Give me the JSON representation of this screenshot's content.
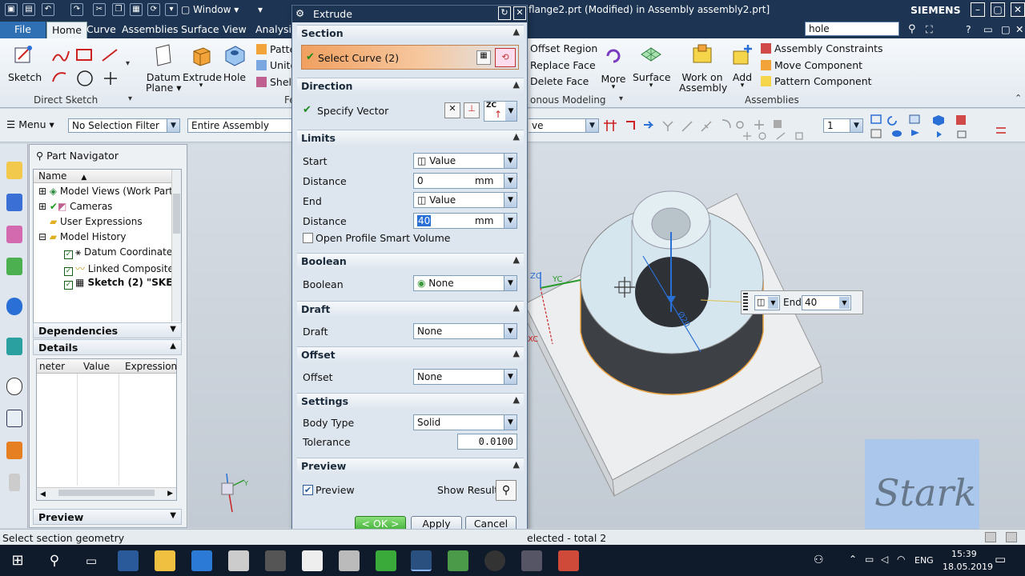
{
  "titlebar": {
    "window_menu": "Window",
    "title": "flange2.prt (Modified)  in Assembly assembly2.prt]",
    "brand": "SIEMENS",
    "search_value": "hole"
  },
  "tabs": [
    "File",
    "Home",
    "Curve",
    "Assemblies",
    "Surface",
    "View",
    "Analysis"
  ],
  "ribbon": {
    "sketch": "Sketch",
    "direct_sketch_group": "Direct Sketch",
    "datum_plane_1": "Datum",
    "datum_plane_2": "Plane",
    "extrude": "Extrude",
    "hole": "Hole",
    "pattern_partial": "Patte",
    "unite_partial": "Unite",
    "shell_partial": "Shell",
    "feature_group_partial": "Fe",
    "offset_region": "Offset Region",
    "replace_face": "Replace Face",
    "delete_face": "Delete Face",
    "synchronous_group": "onous Modeling",
    "more": "More",
    "surface": "Surface",
    "work_on_assembly_1": "Work on",
    "work_on_assembly_2": "Assembly",
    "add": "Add",
    "assembly_constraints": "Assembly Constraints",
    "move_component": "Move Component",
    "pattern_component": "Pattern Component",
    "assemblies_group": "Assemblies"
  },
  "toolbar": {
    "menu": "Menu",
    "selection_filter": "No Selection Filter",
    "scope": "Entire Assembly",
    "snap_partial": "ve",
    "layer_value": "1"
  },
  "part_navigator": {
    "title": "Part Navigator",
    "column_name": "Name",
    "rows": [
      "Model Views (Work Part",
      "Cameras",
      "User Expressions",
      "Model History",
      "Datum Coordinate",
      "Linked Composite",
      "Sketch (2) \"SKET"
    ],
    "dependencies": "Dependencies",
    "details": "Details",
    "details_columns": [
      "neter",
      "Value",
      "Expression"
    ],
    "preview": "Preview"
  },
  "dialog": {
    "title": "Extrude",
    "section": {
      "header": "Section",
      "select_curve": "Select Curve (2)"
    },
    "direction": {
      "header": "Direction",
      "specify_vector": "Specify Vector",
      "vector_label": "ZC"
    },
    "limits": {
      "header": "Limits",
      "start_label": "Start",
      "start_value": "Value",
      "distance1_label": "Distance",
      "distance1_value": "0",
      "unit1": "mm",
      "end_label": "End",
      "end_value": "Value",
      "distance2_label": "Distance",
      "distance2_value": "40",
      "unit2": "mm",
      "open_profile": "Open Profile Smart Volume"
    },
    "boolean": {
      "header": "Boolean",
      "label": "Boolean",
      "value": "None"
    },
    "draft": {
      "header": "Draft",
      "label": "Draft",
      "value": "None"
    },
    "offset": {
      "header": "Offset",
      "label": "Offset",
      "value": "None"
    },
    "settings": {
      "header": "Settings",
      "body_type_label": "Body Type",
      "body_type_value": "Solid",
      "tolerance_label": "Tolerance",
      "tolerance_value": "0.0100"
    },
    "preview": {
      "header": "Preview",
      "preview_label": "Preview",
      "show_result": "Show Result"
    },
    "buttons": {
      "ok": "< OK >",
      "apply": "Apply",
      "cancel": "Cancel"
    }
  },
  "viewport": {
    "end_label": "End",
    "end_value": "40",
    "dim_label": "Ø20",
    "axis_zc": "ZC",
    "axis_yc": "YC",
    "axis_xc": "XC",
    "triad_y": "Y",
    "watermark": "Stark"
  },
  "statusbar": {
    "left": "Select section geometry",
    "right": "elected - total 2"
  },
  "taskbar": {
    "language": "ENG",
    "time": "15:39",
    "date": "18.05.2019"
  },
  "colors": {
    "title_bg": "#1d3553",
    "accent": "#2f6fb3",
    "select_highlight": "#f0a060"
  }
}
